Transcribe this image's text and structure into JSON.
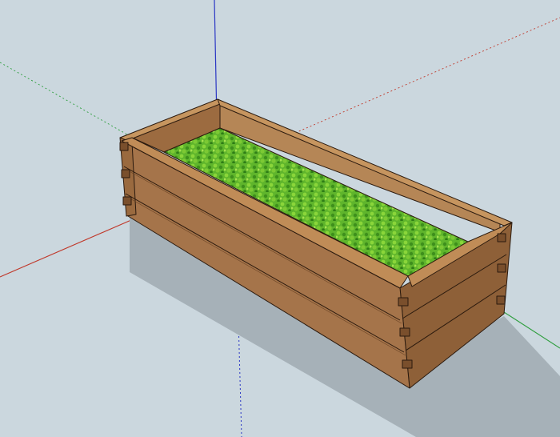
{
  "viewport": {
    "background": "#cbd7de",
    "model": "wooden-raised-planter-with-grass",
    "axes": {
      "red": "#c0392b",
      "green": "#2e9e3e",
      "blue": "#2a36c4"
    },
    "colors": {
      "wood_top": "#b8875a",
      "wood_front": "#a5744a",
      "wood_side": "#8e6038",
      "wood_inner": "#9c6b40",
      "outline": "#2b1a0e",
      "grass_light": "#8ad63a",
      "grass_dark": "#2f7d16",
      "shadow": "#a6b1b8"
    }
  }
}
